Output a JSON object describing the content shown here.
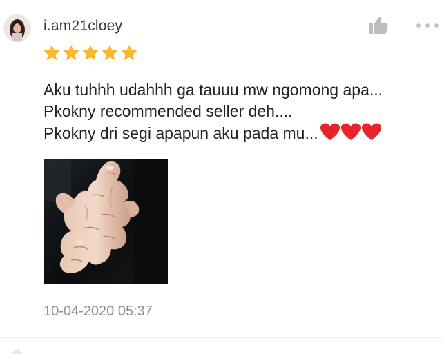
{
  "review": {
    "username": "i.am21cloey",
    "rating": 5,
    "rating_max": 5,
    "comment_lines": [
      "Aku tuhhh udahhh ga tauuu mw ngomong apa...",
      "Pkokny recommended seller deh....",
      "Pkokny dri segi apapun aku pada mu..."
    ],
    "comment_emoji": "❤❤❤",
    "timestamp": "10-04-2020 05:37",
    "photo_icon": "ginger-root-photo",
    "avatar_icon": "user-avatar",
    "like_icon": "thumbs-up-icon",
    "more_icon": "more-dots-icon"
  },
  "colors": {
    "star": "#FDB92C",
    "heart": "#E8232B",
    "muted_icon": "#BDBDBD",
    "timestamp": "#8F8F8F"
  }
}
